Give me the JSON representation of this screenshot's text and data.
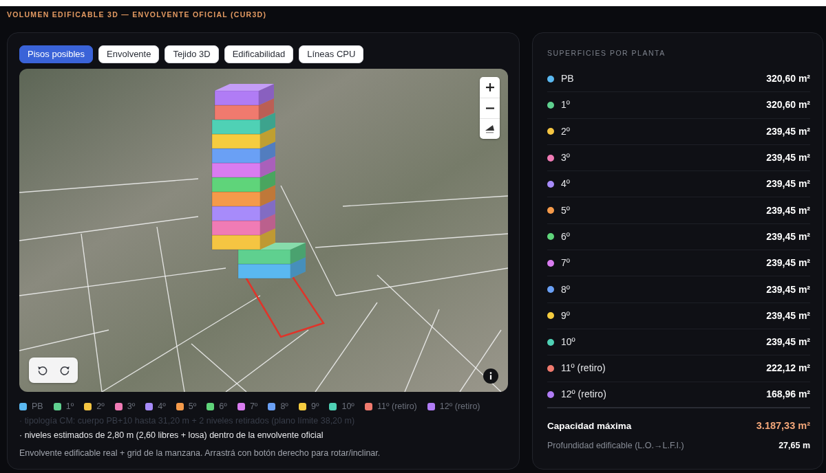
{
  "page": {
    "title": "VOLUMEN EDIFICABLE 3D — ENVOLVENTE OFICIAL (CUR3D)"
  },
  "view_tabs": [
    {
      "label": "Pisos posibles",
      "selected": true
    },
    {
      "label": "Envolvente",
      "selected": false
    },
    {
      "label": "Tejido 3D",
      "selected": false
    },
    {
      "label": "Edificabilidad",
      "selected": false
    },
    {
      "label": "Líneas CPU",
      "selected": false
    }
  ],
  "legend": [
    {
      "label": "PB",
      "color": "#5ab8f0"
    },
    {
      "label": "1º",
      "color": "#5fd08f"
    },
    {
      "label": "2º",
      "color": "#f5c542"
    },
    {
      "label": "3º",
      "color": "#f07bb5"
    },
    {
      "label": "4º",
      "color": "#a78bfa"
    },
    {
      "label": "5º",
      "color": "#f59a4a"
    },
    {
      "label": "6º",
      "color": "#5fd47a"
    },
    {
      "label": "7º",
      "color": "#d97cf0"
    },
    {
      "label": "8º",
      "color": "#6aa0f5"
    },
    {
      "label": "9º",
      "color": "#f5cc3f"
    },
    {
      "label": "10º",
      "color": "#4fd1b5"
    },
    {
      "label": "11º (retiro)",
      "color": "#f07a6e"
    },
    {
      "label": "12º (retiro)",
      "color": "#b07cf5"
    }
  ],
  "notes": [
    {
      "text": "· tipología CM: cuerpo PB+10 hasta 31,20 m + 2 niveles retirados (plano límite 38,20 m)",
      "kind": "dim"
    },
    {
      "text": "· niveles estimados de 2,80 m (2,60 libres + losa) dentro de la envolvente oficial",
      "kind": "bright"
    }
  ],
  "hint": "Envolvente edificable real + grid de la manzana. Arrastrá con botón derecho para rotar/inclinar.",
  "areas_panel": {
    "heading": "SUPERFICIES POR PLANTA",
    "floors": [
      {
        "label": "PB",
        "color": "#5ab8f0",
        "area": "320,60 m²"
      },
      {
        "label": "1º",
        "color": "#5fd08f",
        "area": "320,60 m²"
      },
      {
        "label": "2º",
        "color": "#f5c542",
        "area": "239,45 m²"
      },
      {
        "label": "3º",
        "color": "#f07bb5",
        "area": "239,45 m²"
      },
      {
        "label": "4º",
        "color": "#a78bfa",
        "area": "239,45 m²"
      },
      {
        "label": "5º",
        "color": "#f59a4a",
        "area": "239,45 m²"
      },
      {
        "label": "6º",
        "color": "#5fd47a",
        "area": "239,45 m²"
      },
      {
        "label": "7º",
        "color": "#d97cf0",
        "area": "239,45 m²"
      },
      {
        "label": "8º",
        "color": "#6aa0f5",
        "area": "239,45 m²"
      },
      {
        "label": "9º",
        "color": "#f5cc3f",
        "area": "239,45 m²"
      },
      {
        "label": "10º",
        "color": "#4fd1b5",
        "area": "239,45 m²"
      },
      {
        "label": "11º (retiro)",
        "color": "#f07a6e",
        "area": "222,12 m²"
      },
      {
        "label": "12º (retiro)",
        "color": "#b07cf5",
        "area": "168,96 m²"
      }
    ],
    "total": {
      "label": "Capacidad máxima",
      "value": "3.187,33 m²"
    },
    "depth": {
      "label": "Profundidad edificable (L.O.→L.F.I.)",
      "value": "27,65 m"
    }
  }
}
